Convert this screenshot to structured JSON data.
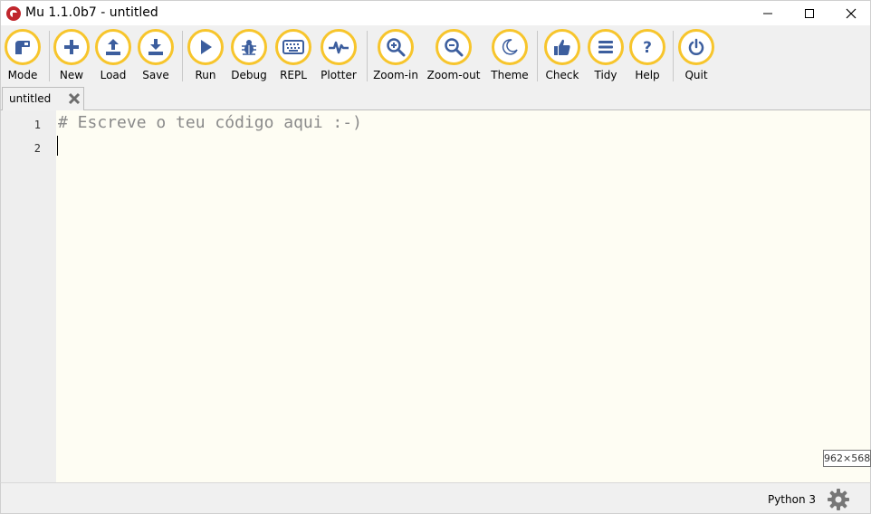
{
  "window": {
    "title": "Mu 1.1.0b7 - untitled",
    "accent_color": "#f7c52c",
    "icon_color": "#3c5e9e"
  },
  "toolbar": {
    "buttons": [
      {
        "id": "mode",
        "label": "Mode",
        "icon": "mode-icon"
      },
      {
        "id": "new",
        "label": "New",
        "icon": "plus-icon"
      },
      {
        "id": "load",
        "label": "Load",
        "icon": "upload-icon"
      },
      {
        "id": "save",
        "label": "Save",
        "icon": "download-icon"
      },
      {
        "id": "run",
        "label": "Run",
        "icon": "play-icon"
      },
      {
        "id": "debug",
        "label": "Debug",
        "icon": "bug-icon"
      },
      {
        "id": "repl",
        "label": "REPL",
        "icon": "keyboard-icon"
      },
      {
        "id": "plotter",
        "label": "Plotter",
        "icon": "pulse-icon"
      },
      {
        "id": "zoom-in",
        "label": "Zoom-in",
        "icon": "zoom-in-icon"
      },
      {
        "id": "zoom-out",
        "label": "Zoom-out",
        "icon": "zoom-out-icon"
      },
      {
        "id": "theme",
        "label": "Theme",
        "icon": "moon-icon"
      },
      {
        "id": "check",
        "label": "Check",
        "icon": "thumbs-up-icon"
      },
      {
        "id": "tidy",
        "label": "Tidy",
        "icon": "lines-icon"
      },
      {
        "id": "help",
        "label": "Help",
        "icon": "question-icon"
      },
      {
        "id": "quit",
        "label": "Quit",
        "icon": "power-icon"
      }
    ]
  },
  "tabs": [
    {
      "label": "untitled",
      "active": true
    }
  ],
  "editor": {
    "line_numbers": [
      "1",
      "2"
    ],
    "lines": [
      "# Escreve o teu código aqui :-)",
      ""
    ]
  },
  "status": {
    "mode": "Python 3"
  },
  "size_tip": "962×568"
}
